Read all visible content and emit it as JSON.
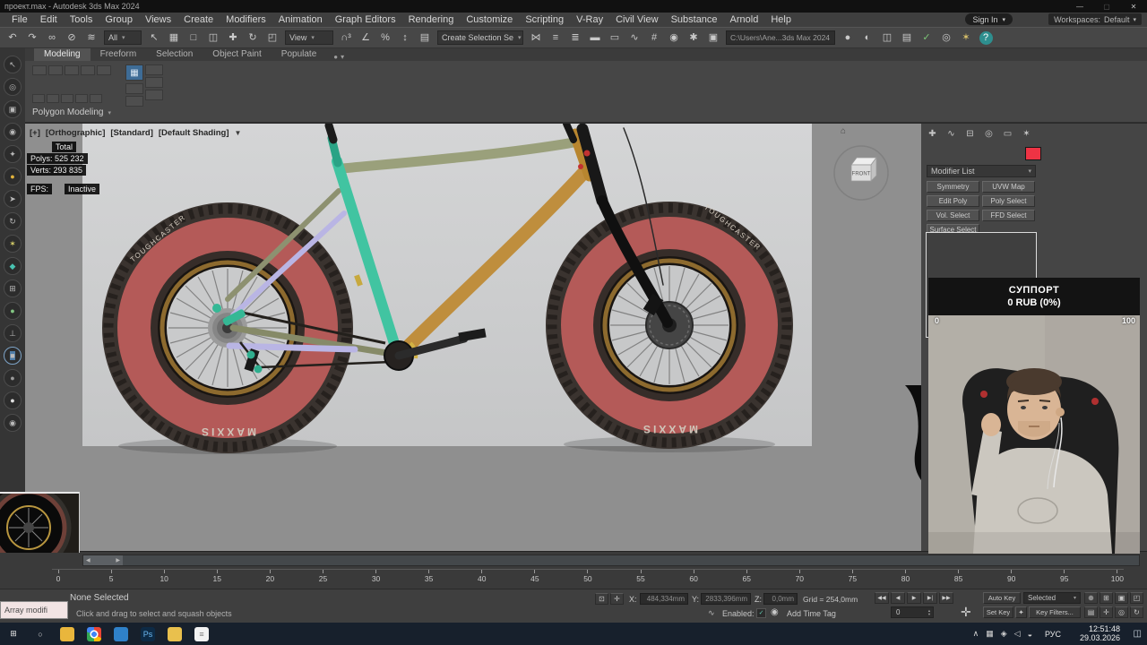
{
  "window": {
    "title": "проект.max - Autodesk 3ds Max 2024",
    "minimize": "—",
    "maximize": "▢",
    "close": "✕"
  },
  "account": {
    "sign_in": "Sign In",
    "caret": "▾",
    "workspaces_label": "Workspaces:",
    "workspace_value": "Default"
  },
  "menu": {
    "items": [
      {
        "label": "File"
      },
      {
        "label": "Edit"
      },
      {
        "label": "Tools"
      },
      {
        "label": "Group"
      },
      {
        "label": "Views"
      },
      {
        "label": "Create"
      },
      {
        "label": "Modifiers"
      },
      {
        "label": "Animation"
      },
      {
        "label": "Graph Editors"
      },
      {
        "label": "Rendering"
      },
      {
        "label": "Customize"
      },
      {
        "label": "Scripting"
      },
      {
        "label": "V-Ray"
      },
      {
        "label": "Civil View"
      },
      {
        "label": "Substance"
      },
      {
        "label": "Arnold"
      },
      {
        "label": "Help"
      }
    ]
  },
  "toolbar": {
    "group_a": [
      {
        "name": "undo-icon",
        "glyph": "↶"
      },
      {
        "name": "redo-icon",
        "glyph": "↷"
      },
      {
        "name": "select-and-link-icon",
        "glyph": "∞"
      },
      {
        "name": "unlink-selection-icon",
        "glyph": "⊘"
      },
      {
        "name": "bind-to-space-warp-icon",
        "glyph": "≋"
      }
    ],
    "all_dropdown": {
      "label": "All"
    },
    "group_b": [
      {
        "name": "select-object-icon",
        "glyph": "↖"
      },
      {
        "name": "select-by-name-icon",
        "glyph": "▦"
      },
      {
        "name": "rectangular-selection-icon",
        "glyph": "□"
      },
      {
        "name": "window-crossing-icon",
        "glyph": "◫"
      }
    ],
    "group_c": [
      {
        "name": "select-and-move-icon",
        "glyph": "✚"
      },
      {
        "name": "select-and-rotate-icon",
        "glyph": "↻"
      },
      {
        "name": "select-and-scale-icon",
        "glyph": "◰"
      }
    ],
    "view_dropdown": {
      "label": "View"
    },
    "group_d": [
      {
        "name": "snaps-toggle-icon",
        "glyph": "∩³"
      },
      {
        "name": "angle-snap-icon",
        "glyph": "∠"
      },
      {
        "name": "percent-snap-icon",
        "glyph": "%"
      },
      {
        "name": "spinner-snap-icon",
        "glyph": "↕"
      }
    ],
    "group_e": [
      {
        "name": "edit-named-selection-sets-icon",
        "glyph": "▤"
      }
    ],
    "selection_dropdown": {
      "label": "Create Selection Se"
    },
    "group_f": [
      {
        "name": "mirror-icon",
        "glyph": "⋈"
      },
      {
        "name": "align-icon",
        "glyph": "≡"
      },
      {
        "name": "scene-explorer-icon",
        "glyph": "≣"
      },
      {
        "name": "layer-explorer-icon",
        "glyph": "▬"
      },
      {
        "name": "toggle-ribbon-icon",
        "glyph": "▭"
      },
      {
        "name": "curve-editor-icon",
        "glyph": "∿"
      },
      {
        "name": "schematic-view-icon",
        "glyph": "#"
      },
      {
        "name": "material-editor-icon",
        "glyph": "◉"
      },
      {
        "name": "render-setup-icon",
        "glyph": "✱"
      },
      {
        "name": "rendered-frame-window-icon",
        "glyph": "▣"
      }
    ],
    "path_field": {
      "value": "C:\\Users\\Ane...3ds Max 2024"
    },
    "group_g": [
      {
        "name": "render-production-icon",
        "glyph": "●"
      },
      {
        "name": "render-iterative-icon",
        "glyph": "◐"
      },
      {
        "name": "viewport-layout-icon",
        "glyph": "◫"
      },
      {
        "name": "scene-states-icon",
        "glyph": "▤"
      },
      {
        "name": "health-check-icon",
        "glyph": "✓",
        "color": "#7cc576"
      },
      {
        "name": "isolate-selection-icon",
        "glyph": "◎"
      },
      {
        "name": "lighting-alert-icon",
        "glyph": "✶",
        "color": "#d9c16a"
      },
      {
        "name": "help-icon",
        "glyph": "?",
        "bg": "#2e8f8f",
        "color": "#ffffff"
      }
    ]
  },
  "ribbon": {
    "tabs": [
      {
        "label": "Modeling",
        "active": true
      },
      {
        "label": "Freeform"
      },
      {
        "label": "Selection"
      },
      {
        "label": "Object Paint"
      },
      {
        "label": "Populate"
      }
    ],
    "options_glyph": "●",
    "options_caret": "▾",
    "polygon_modeling_label": "Polygon Modeling",
    "caret": "▾"
  },
  "left_toolbar": {
    "icons": [
      {
        "name": "select-tool-icon",
        "glyph": "↖"
      },
      {
        "name": "magnet-tool-icon",
        "glyph": "◎"
      },
      {
        "name": "camera-tool-icon",
        "glyph": "▣"
      },
      {
        "name": "video-tool-icon",
        "glyph": "◉"
      },
      {
        "name": "light-tool-icon",
        "glyph": "✦"
      },
      {
        "name": "sun-tool-icon",
        "glyph": "●",
        "color": "#e2b33c"
      },
      {
        "name": "pick-tool-icon",
        "glyph": "➤"
      },
      {
        "name": "rotate-tool-icon",
        "glyph": "↻"
      },
      {
        "name": "star-tool-icon",
        "glyph": "✶",
        "color": "#d8d06a"
      },
      {
        "name": "diamond-tool-icon",
        "glyph": "◆",
        "color": "#49c2b1"
      },
      {
        "name": "grid-tool-icon",
        "glyph": "⊞"
      },
      {
        "name": "sphere-tool-icon",
        "glyph": "●",
        "color": "#83c683"
      },
      {
        "name": "axis-tool-icon",
        "glyph": "⊥"
      },
      {
        "name": "cube-tool-icon",
        "glyph": "■",
        "bg": "#4f7ca6",
        "active": true
      },
      {
        "name": "circle-tool-icon",
        "glyph": "●",
        "color": "#9a9a9a"
      },
      {
        "name": "ball-tool-icon",
        "glyph": "●",
        "color": "#e0e0e0"
      },
      {
        "name": "eye-tool-icon",
        "glyph": "◉"
      }
    ]
  },
  "viewport": {
    "header": {
      "plus": "[+]",
      "view": "[Orthographic]",
      "style": "[Standard]",
      "shading": "[Default Shading]",
      "caret": "▾",
      "funnel": "▼"
    },
    "stats": {
      "total": "Total",
      "polys": "Polys: 525 232",
      "verts": "Verts: 293 835",
      "fps_label": "FPS:",
      "fps_value": "Inactive"
    },
    "viewcube_label": "FRONT",
    "tire_brand": "MAXXIS",
    "tire_model": "TOUGHCASTER"
  },
  "command_panel": {
    "tabs": [
      {
        "name": "create-tab-icon",
        "glyph": "✚"
      },
      {
        "name": "modify-tab-icon",
        "glyph": "∿"
      },
      {
        "name": "hierarchy-tab-icon",
        "glyph": "⊟"
      },
      {
        "name": "motion-tab-icon",
        "glyph": "◎"
      },
      {
        "name": "display-tab-icon",
        "glyph": "▭"
      },
      {
        "name": "utilities-tab-icon",
        "glyph": "✶"
      }
    ],
    "modifier_list_label": "Modifier List",
    "dropdown_caret": "▾",
    "buttons": [
      {
        "label": "Symmetry"
      },
      {
        "label": "UVW Map"
      },
      {
        "label": "Edit Poly"
      },
      {
        "label": "Poly Select"
      },
      {
        "label": "Vol. Select"
      },
      {
        "label": "FFD Select"
      },
      {
        "label": "Surface Select"
      }
    ]
  },
  "donation": {
    "title": "СУППОРТ",
    "amount": "0 RUB (0%)",
    "min": "0",
    "max": "100"
  },
  "timeline": {
    "ticks": [
      {
        "label": "0"
      },
      {
        "label": "5"
      },
      {
        "label": "10"
      },
      {
        "label": "15"
      },
      {
        "label": "20"
      },
      {
        "label": "25"
      },
      {
        "label": "30"
      },
      {
        "label": "35"
      },
      {
        "label": "40"
      },
      {
        "label": "45"
      },
      {
        "label": "50"
      },
      {
        "label": "55"
      },
      {
        "label": "60"
      },
      {
        "label": "65"
      },
      {
        "label": "70"
      },
      {
        "label": "75"
      },
      {
        "label": "80"
      },
      {
        "label": "85"
      },
      {
        "label": "90"
      },
      {
        "label": "95"
      },
      {
        "label": "100"
      }
    ]
  },
  "status_bar": {
    "selection_prompt": "None Selected",
    "hint": "Click and drag to select and squash objects",
    "tooltip": "Array modifi",
    "lock_icons": [
      {
        "name": "selection-lock-icon",
        "glyph": "⊡"
      },
      {
        "name": "absolute-offset-icon",
        "glyph": "✛"
      }
    ],
    "x_label": "X:",
    "x_value": "484,334mm",
    "y_label": "Y:",
    "y_value": "2833,396mm",
    "z_label": "Z:",
    "z_value": "0,0mm",
    "grid": "Grid = 254,0mm",
    "mini_curve_glyph": "∿",
    "enabled_label": "Enabled:",
    "check_glyph": "✓",
    "clock_glyph": "◉",
    "add_time_tag": "Add Time Tag",
    "playback": [
      {
        "name": "go-to-start-button",
        "glyph": "◀◀"
      },
      {
        "name": "previous-frame-button",
        "glyph": "◀"
      },
      {
        "name": "play-button",
        "glyph": "▶"
      },
      {
        "name": "next-frame-button",
        "glyph": "▶|"
      },
      {
        "name": "go-to-end-button",
        "glyph": "▶▶"
      }
    ],
    "auto_key": "Auto Key",
    "selected_dropdown": "Selected",
    "pan_glyph": "✛",
    "set_key": "Set Key",
    "key_glyph": "✦",
    "key_filters": "Key Filters...",
    "frame_value": "0",
    "nav_icons_row1": [
      {
        "name": "zoom-icon",
        "glyph": "⊕"
      },
      {
        "name": "zoom-all-icon",
        "glyph": "⊞"
      },
      {
        "name": "zoom-extents-icon",
        "glyph": "▣"
      },
      {
        "name": "maximize-viewport-icon",
        "glyph": "◰"
      }
    ],
    "nav_icons_row2": [
      {
        "name": "keyboard-override-icon",
        "glyph": "▤"
      },
      {
        "name": "pan-view-icon",
        "glyph": "✛"
      },
      {
        "name": "field-of-view-icon",
        "glyph": "◎"
      },
      {
        "name": "orbit-icon",
        "glyph": "↻"
      }
    ]
  },
  "taskbar": {
    "items": [
      {
        "name": "start-button",
        "glyph": "⊞",
        "color": "#eaeaea"
      },
      {
        "name": "search-button",
        "glyph": "○",
        "color": "#d8d8d8"
      },
      {
        "name": "file-explorer-button",
        "glyph": "",
        "bg": "#e9b63c"
      },
      {
        "name": "chrome-button",
        "glyph": "",
        "bg": "radial-gradient(circle, #4286f5 0 3px, #ffffff 3px 4.5px, rgba(0,0,0,0) 4.5px), conic-gradient(#ea4435 0 33%, #fbbc04 33% 50%, #34a853 50% 80%, #4286f5 80%)"
      },
      {
        "name": "code-app-button",
        "glyph": "",
        "bg": "#2f81c9"
      },
      {
        "name": "photoshop-button",
        "glyph": "Ps",
        "bg": "#0d2a45",
        "color": "#6cb8f0"
      },
      {
        "name": "folder-button",
        "glyph": "",
        "bg": "#e9c04d"
      },
      {
        "name": "notepad-button",
        "glyph": "≡",
        "bg": "#f2f2f2",
        "color": "#7a7a7a"
      }
    ],
    "tray": [
      {
        "name": "tray-expand-icon",
        "glyph": "∧"
      },
      {
        "name": "tray-app-icon-1",
        "glyph": "▦"
      },
      {
        "name": "tray-app-icon-2",
        "glyph": "◈"
      },
      {
        "name": "volume-icon",
        "glyph": "◁"
      },
      {
        "name": "network-icon",
        "glyph": "◒"
      }
    ],
    "lang": "РУС",
    "time": "12:51:48",
    "date": "29.03.2026",
    "notification_glyph": "◫"
  }
}
